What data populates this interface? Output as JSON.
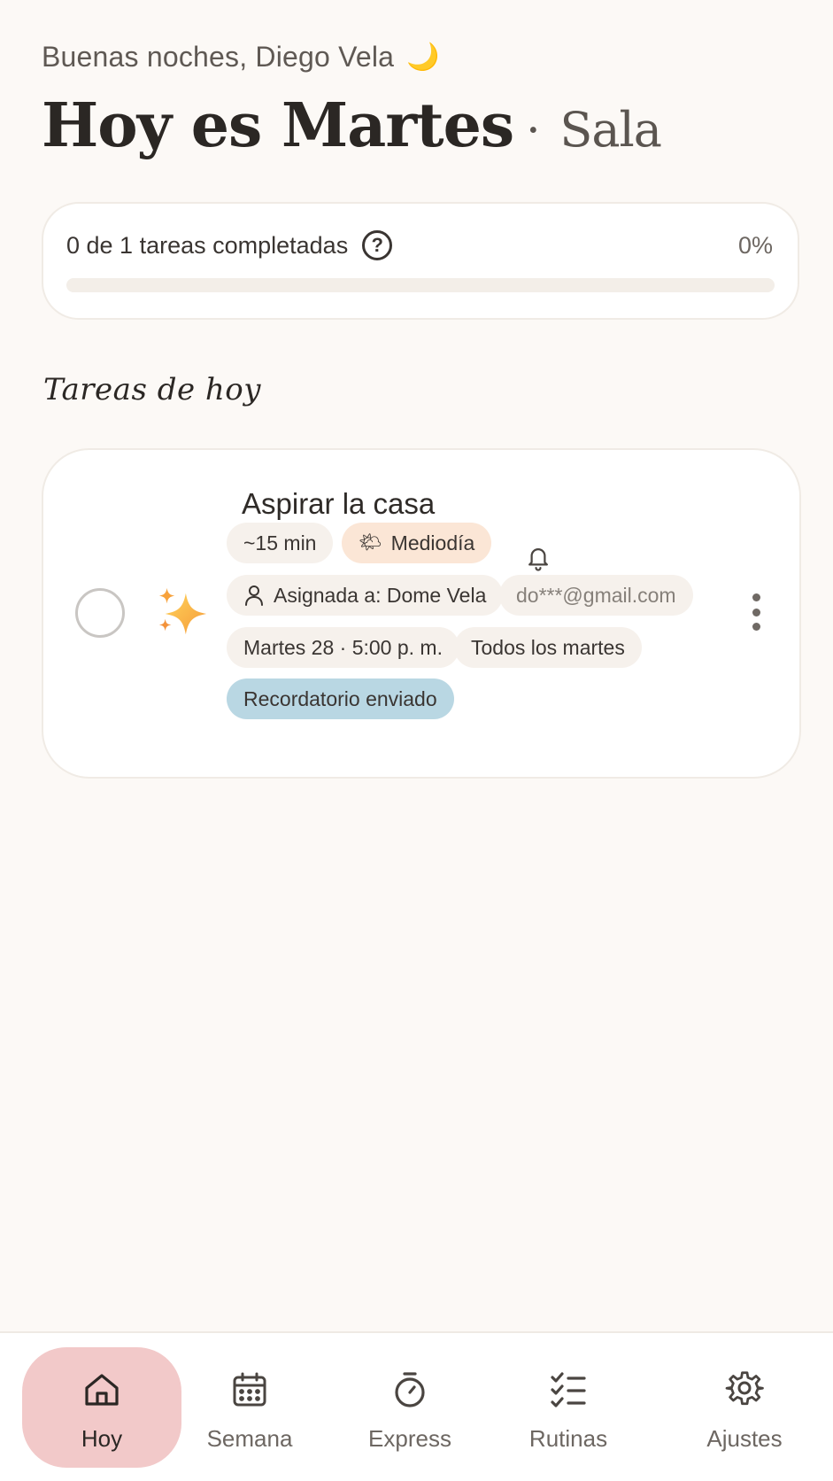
{
  "header": {
    "greeting": "Buenas noches, Diego Vela",
    "greeting_emoji": "🌙",
    "title": "Hoy es Martes",
    "separator": "·",
    "room": "Sala"
  },
  "progress": {
    "label": "0 de 1 tareas completadas",
    "help_icon": "?",
    "percent_label": "0%",
    "percent_value": 0
  },
  "section": {
    "title": "Tareas de hoy"
  },
  "task": {
    "title": "Aspirar la casa",
    "icon": "sparkles-icon",
    "duration": "~15 min",
    "time_of_day": "Mediodía",
    "time_of_day_emoji": "🌤",
    "assigned": "Asignada a: Dome Vela",
    "email": "do***@gmail.com",
    "datetime": "Martes 28 · 5:00 p. m.",
    "recurrence": "Todos los martes",
    "reminder_status": "Recordatorio enviado"
  },
  "nav": {
    "items": [
      {
        "label": "Hoy",
        "icon": "home-icon",
        "active": true
      },
      {
        "label": "Semana",
        "icon": "calendar-icon",
        "active": false
      },
      {
        "label": "Express",
        "icon": "stopwatch-icon",
        "active": false
      },
      {
        "label": "Rutinas",
        "icon": "checklist-icon",
        "active": false
      },
      {
        "label": "Ajustes",
        "icon": "gear-icon",
        "active": false
      }
    ]
  },
  "colors": {
    "background": "#fcf9f6",
    "active_nav": "#f2c9c9",
    "chip_peach": "#fbe6d6",
    "chip_blue": "#b9d7e3"
  }
}
